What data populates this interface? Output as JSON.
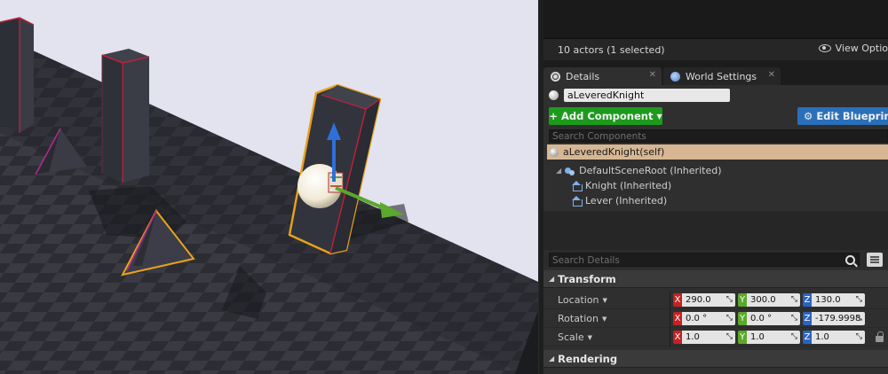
{
  "outliner": {
    "actor_count": "10 actors (1 selected)",
    "view_options": "View Optio"
  },
  "tabs": [
    {
      "label": "Details",
      "close": "✕"
    },
    {
      "label": "World Settings",
      "close": "✕"
    }
  ],
  "details": {
    "actor_name": "aLeveredKnight",
    "add_component_label": "Add Component",
    "edit_blueprint_label": "Edit Blueprin",
    "search_components_placeholder": "Search Components",
    "self_component": "aLeveredKnight(self)",
    "tree": [
      {
        "label": "DefaultSceneRoot (Inherited)"
      },
      {
        "label": "Knight (Inherited)"
      },
      {
        "label": "Lever (Inherited)"
      }
    ],
    "search_details_placeholder": "Search Details"
  },
  "transform": {
    "category": "Transform",
    "location": {
      "label": "Location",
      "x": "290.0",
      "y": "300.0",
      "z": "130.0"
    },
    "rotation": {
      "label": "Rotation",
      "x": "0.0 °",
      "y": "0.0 °",
      "z": "-179.9998"
    },
    "scale": {
      "label": "Scale",
      "x": "1.0",
      "y": "1.0",
      "z": "1.0"
    }
  },
  "rendering": {
    "category": "Rendering"
  },
  "axes": {
    "x": "X",
    "y": "Y",
    "z": "Z"
  },
  "colors": {
    "add_component": "#1d9a1d",
    "edit_blueprint": "#2a6fba",
    "selected_row": "#d7b793",
    "axis_x": "#c42222",
    "axis_y": "#5ba82a",
    "axis_z": "#2b64c0",
    "selection_outline": "#e8a21c"
  }
}
